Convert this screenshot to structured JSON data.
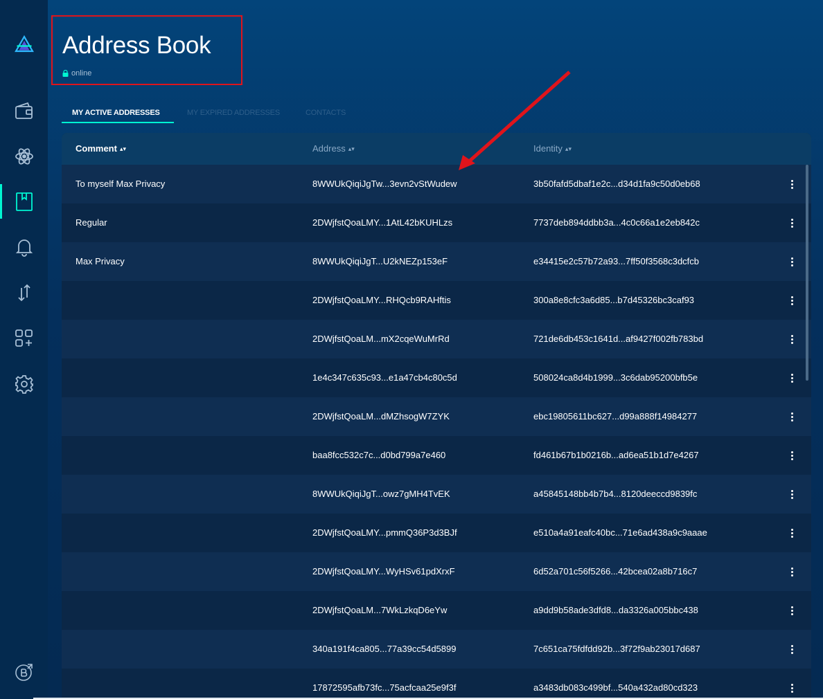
{
  "header": {
    "title": "Address Book",
    "status": "online"
  },
  "tabs": [
    {
      "label": "MY ACTIVE ADDRESSES",
      "active": true
    },
    {
      "label": "MY EXPIRED ADDRESSES",
      "active": false
    },
    {
      "label": "CONTACTS",
      "active": false
    }
  ],
  "table": {
    "columns": [
      "Comment",
      "Address",
      "Identity"
    ],
    "rows": [
      {
        "comment": "To myself  Max Privacy",
        "address": "8WWUkQiqiJgTw...3evn2vStWudew",
        "identity": "3b50fafd5dbaf1e2c...d34d1fa9c50d0eb68"
      },
      {
        "comment": "Regular",
        "address": "2DWjfstQoaLMY...1AtL42bKUHLzs",
        "identity": "7737deb894ddbb3a...4c0c66a1e2eb842c"
      },
      {
        "comment": "Max Privacy",
        "address": "8WWUkQiqiJgT...U2kNEZp153eF",
        "identity": "e34415e2c57b72a93...7ff50f3568c3dcfcb"
      },
      {
        "comment": "",
        "address": "2DWjfstQoaLMY...RHQcb9RAHftis",
        "identity": "300a8e8cfc3a6d85...b7d45326bc3caf93"
      },
      {
        "comment": "",
        "address": "2DWjfstQoaLM...mX2cqeWuMrRd",
        "identity": "721de6db453c1641d...af9427f002fb783bd"
      },
      {
        "comment": "",
        "address": "1e4c347c635c93...e1a47cb4c80c5d",
        "identity": "508024ca8d4b1999...3c6dab95200bfb5e"
      },
      {
        "comment": "",
        "address": "2DWjfstQoaLM...dMZhsogW7ZYK",
        "identity": "ebc19805611bc627...d99a888f14984277"
      },
      {
        "comment": "",
        "address": "baa8fcc532c7c...d0bd799a7e460",
        "identity": "fd461b67b1b0216b...ad6ea51b1d7e4267"
      },
      {
        "comment": "",
        "address": "8WWUkQiqiJgT...owz7gMH4TvEK",
        "identity": "a45845148bb4b7b4...8120deeccd9839fc"
      },
      {
        "comment": "",
        "address": "2DWjfstQoaLMY...pmmQ36P3d3BJf",
        "identity": "e510a4a91eafc40bc...71e6ad438a9c9aaae"
      },
      {
        "comment": "",
        "address": "2DWjfstQoaLMY...WyHSv61pdXrxF",
        "identity": "6d52a701c56f5266...42bcea02a8b716c7"
      },
      {
        "comment": "",
        "address": "2DWjfstQoaLM...7WkLzkqD6eYw",
        "identity": "a9dd9b58ade3dfd8...da3326a005bbc438"
      },
      {
        "comment": "",
        "address": "340a191f4ca805...77a39cc54d5899",
        "identity": "7c651ca75fdfdd92b...3f72f9ab23017d687"
      },
      {
        "comment": "",
        "address": "17872595afb73fc...75acfcaa25e9f3f",
        "identity": "a3483db083c499bf...540a432ad80cd323"
      }
    ]
  },
  "colors": {
    "accent": "#00f6d2",
    "annotation": "#e0141b"
  }
}
